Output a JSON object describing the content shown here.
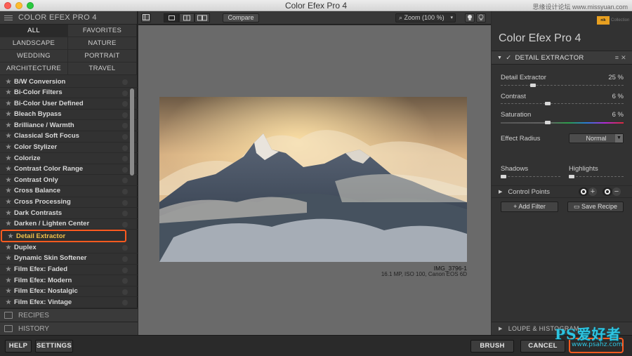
{
  "window": {
    "title": "Color Efex Pro 4",
    "watermark_top": "思缘设计论坛 www.missyuan.com"
  },
  "left": {
    "header": "COLOR EFEX PRO 4",
    "categories": [
      "ALL",
      "FAVORITES",
      "LANDSCAPE",
      "NATURE",
      "WEDDING",
      "PORTRAIT",
      "ARCHITECTURE",
      "TRAVEL"
    ],
    "filters": [
      "B/W Conversion",
      "Bi-Color Filters",
      "Bi-Color User Defined",
      "Bleach Bypass",
      "Brilliance / Warmth",
      "Classical Soft Focus",
      "Color Stylizer",
      "Colorize",
      "Contrast Color Range",
      "Contrast Only",
      "Cross Balance",
      "Cross Processing",
      "Dark Contrasts",
      "Darken / Lighten Center",
      "Detail Extractor",
      "Duplex",
      "Dynamic Skin Softener",
      "Film Efex: Faded",
      "Film Efex: Modern",
      "Film Efex: Nostalgic",
      "Film Efex: Vintage"
    ],
    "selected_filter": "Detail Extractor",
    "recipes": "RECIPES",
    "history": "HISTORY"
  },
  "toolbar": {
    "compare": "Compare",
    "zoom": "Zoom (100 %)"
  },
  "preview": {
    "image_name": "IMG_3796-1",
    "image_meta": "16.1 MP, ISO 100, Canon EOS 6D"
  },
  "right": {
    "brand_badge": "nik",
    "brand_collection": "Collection",
    "app_title": "Color Efex Pro 4",
    "filter_header": "DETAIL EXTRACTOR",
    "params": {
      "detail_extractor": {
        "label": "Detail Extractor",
        "value": "25 %",
        "level": 0.25
      },
      "contrast": {
        "label": "Contrast",
        "value": "6 %",
        "level": 0.38
      },
      "saturation": {
        "label": "Saturation",
        "value": "6 %",
        "level": 0.38
      }
    },
    "effect_radius": {
      "label": "Effect Radius",
      "value": "Normal"
    },
    "shadows": "Shadows",
    "highlights": "Highlights",
    "control_points": "Control Points",
    "add_filter": "Add Filter",
    "save_recipe": "Save Recipe",
    "loupe": "LOUPE & HISTOGRAM"
  },
  "bottom": {
    "help": "HELP",
    "settings": "SETTINGS",
    "brush": "BRUSH",
    "cancel": "CANCEL"
  },
  "site_watermark": {
    "big": "PS爱好者",
    "small": "www.psahz.com"
  }
}
